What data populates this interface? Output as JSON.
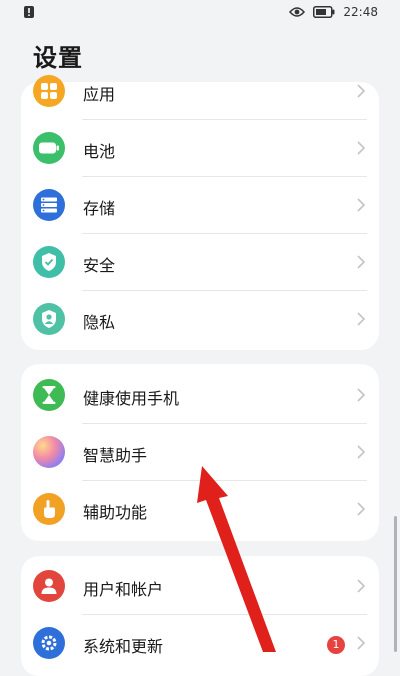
{
  "status_bar": {
    "time": "22:48",
    "icons": [
      "alert-icon",
      "eye-icon",
      "battery-icon"
    ]
  },
  "page": {
    "title": "设置"
  },
  "groups": [
    {
      "items": [
        {
          "label": "应用",
          "icon": "apps-icon",
          "color": "#f5a623"
        },
        {
          "label": "电池",
          "icon": "battery-icon",
          "color": "#3cbf6b"
        },
        {
          "label": "存储",
          "icon": "storage-icon",
          "color": "#2f6fd9"
        },
        {
          "label": "安全",
          "icon": "shield-icon",
          "color": "#3fbfa8"
        },
        {
          "label": "隐私",
          "icon": "privacy-icon",
          "color": "#4fc2a6"
        }
      ]
    },
    {
      "items": [
        {
          "label": "健康使用手机",
          "icon": "hourglass-icon",
          "color": "#3fbb55"
        },
        {
          "label": "智慧助手",
          "icon": "assistant-icon",
          "color": "#9c86e6"
        },
        {
          "label": "辅助功能",
          "icon": "hand-icon",
          "color": "#f1a224"
        }
      ]
    },
    {
      "items": [
        {
          "label": "用户和帐户",
          "icon": "user-icon",
          "color": "#e2453c"
        },
        {
          "label": "系统和更新",
          "icon": "gear-icon",
          "color": "#2f6fd9",
          "badge": "1"
        }
      ]
    }
  ],
  "annotation": {
    "type": "arrow",
    "color": "#e0201b",
    "target": "智慧助手"
  }
}
